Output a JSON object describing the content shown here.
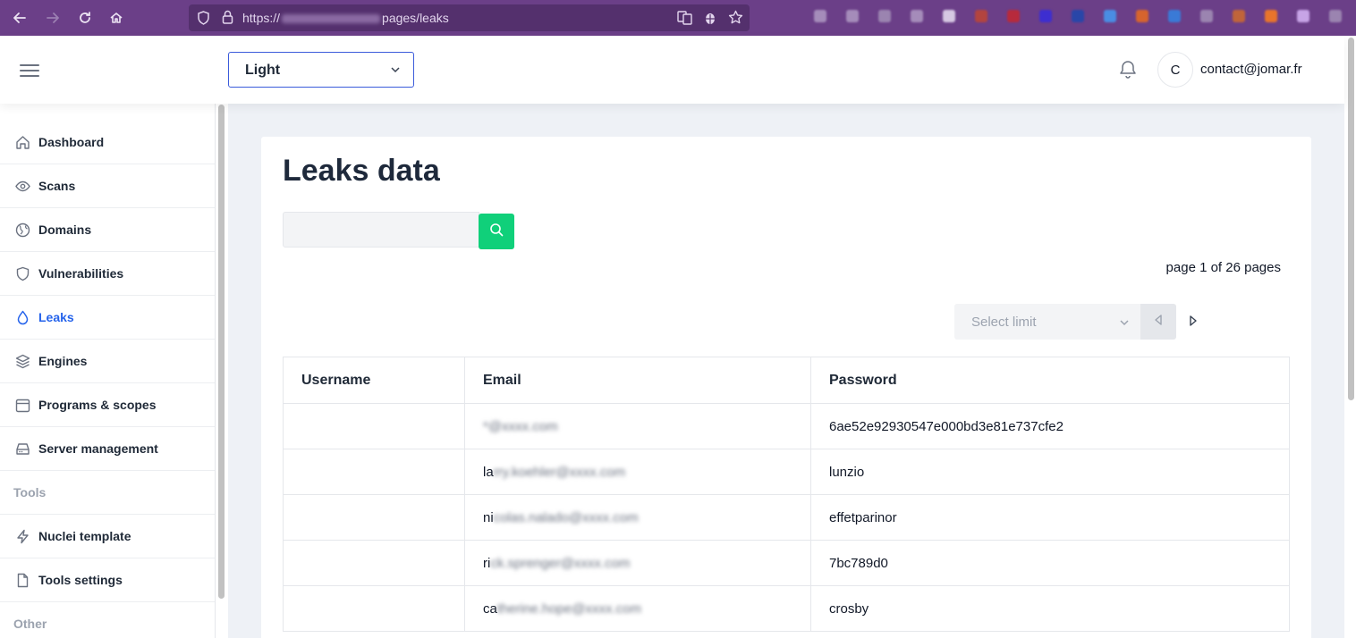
{
  "browser": {
    "url_prefix": "https://",
    "url_suffix": "pages/leaks"
  },
  "header": {
    "theme_value": "Light",
    "avatar_initial": "C",
    "user_email": "contact@jomar.fr"
  },
  "sidebar": {
    "items": [
      {
        "label": "Dashboard",
        "icon": "home-icon"
      },
      {
        "label": "Scans",
        "icon": "eye-icon"
      },
      {
        "label": "Domains",
        "icon": "globe-icon"
      },
      {
        "label": "Vulnerabilities",
        "icon": "shield-icon"
      },
      {
        "label": "Leaks",
        "icon": "droplet-icon",
        "active": true
      },
      {
        "label": "Engines",
        "icon": "layers-icon"
      },
      {
        "label": "Programs & scopes",
        "icon": "calendar-icon"
      },
      {
        "label": "Server management",
        "icon": "server-icon"
      }
    ],
    "section_tools": "Tools",
    "tools_items": [
      {
        "label": "Nuclei template",
        "icon": "lightning-icon"
      },
      {
        "label": "Tools settings",
        "icon": "file-icon"
      }
    ],
    "section_other": "Other"
  },
  "main": {
    "title": "Leaks data",
    "pagination_text": "page 1 of 26 pages",
    "limit_placeholder": "Select limit",
    "table": {
      "headers": [
        "Username",
        "Email",
        "Password"
      ],
      "rows": [
        {
          "username": "",
          "email_visible": "",
          "email_blurred": "*@xxxx.com",
          "password": "6ae52e92930547e000bd3e81e737cfe2"
        },
        {
          "username": "",
          "email_visible": "la",
          "email_blurred": "rry.koehler@xxxx.com",
          "password": "lunzio"
        },
        {
          "username": "",
          "email_visible": "ni",
          "email_blurred": "colas.nalado@xxxx.com",
          "password": "effetparinor"
        },
        {
          "username": "",
          "email_visible": "ri",
          "email_blurred": "ck.sprenger@xxxx.com",
          "password": "7bc789d0"
        },
        {
          "username": "",
          "email_visible": "ca",
          "email_blurred": "therine.hope@xxxx.com",
          "password": "crosby"
        }
      ]
    }
  },
  "colors": {
    "browser_bar": "#6b3f88",
    "accent_blue": "#2563eb",
    "search_green": "#10d07a",
    "main_bg": "#eef1f6"
  }
}
